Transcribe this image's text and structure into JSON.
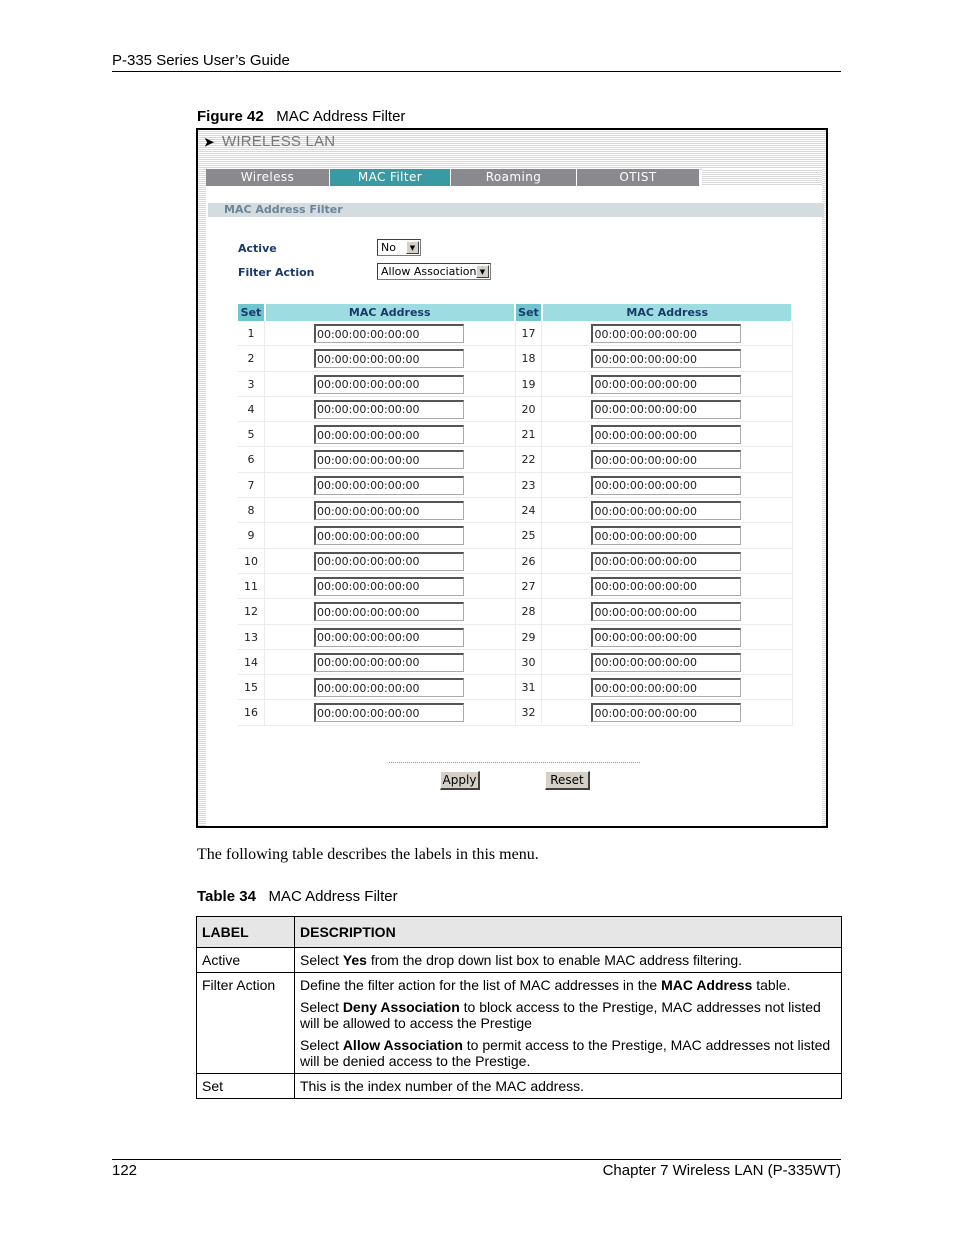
{
  "page": {
    "running_head": "P-335 Series User’s Guide",
    "page_number": "122",
    "chapter": "Chapter 7 Wireless LAN (P-335WT)"
  },
  "figure": {
    "label": "Figure 42",
    "title": "MAC Address Filter"
  },
  "screenshot": {
    "window_title": "WIRELESS LAN",
    "tabs": [
      {
        "label": "Wireless",
        "active": false
      },
      {
        "label": "MAC Filter",
        "active": true
      },
      {
        "label": "Roaming",
        "active": false
      },
      {
        "label": "OTIST",
        "active": false
      }
    ],
    "section_title": "MAC Address Filter",
    "active": {
      "label": "Active",
      "value": "No"
    },
    "filter_action": {
      "label": "Filter Action",
      "value": "Allow Association"
    },
    "columns": {
      "set": "Set",
      "mac": "MAC Address"
    },
    "left_rows": [
      {
        "set": "1",
        "mac": "00:00:00:00:00:00"
      },
      {
        "set": "2",
        "mac": "00:00:00:00:00:00"
      },
      {
        "set": "3",
        "mac": "00:00:00:00:00:00"
      },
      {
        "set": "4",
        "mac": "00:00:00:00:00:00"
      },
      {
        "set": "5",
        "mac": "00:00:00:00:00:00"
      },
      {
        "set": "6",
        "mac": "00:00:00:00:00:00"
      },
      {
        "set": "7",
        "mac": "00:00:00:00:00:00"
      },
      {
        "set": "8",
        "mac": "00:00:00:00:00:00"
      },
      {
        "set": "9",
        "mac": "00:00:00:00:00:00"
      },
      {
        "set": "10",
        "mac": "00:00:00:00:00:00"
      },
      {
        "set": "11",
        "mac": "00:00:00:00:00:00"
      },
      {
        "set": "12",
        "mac": "00:00:00:00:00:00"
      },
      {
        "set": "13",
        "mac": "00:00:00:00:00:00"
      },
      {
        "set": "14",
        "mac": "00:00:00:00:00:00"
      },
      {
        "set": "15",
        "mac": "00:00:00:00:00:00"
      },
      {
        "set": "16",
        "mac": "00:00:00:00:00:00"
      }
    ],
    "right_rows": [
      {
        "set": "17",
        "mac": "00:00:00:00:00:00"
      },
      {
        "set": "18",
        "mac": "00:00:00:00:00:00"
      },
      {
        "set": "19",
        "mac": "00:00:00:00:00:00"
      },
      {
        "set": "20",
        "mac": "00:00:00:00:00:00"
      },
      {
        "set": "21",
        "mac": "00:00:00:00:00:00"
      },
      {
        "set": "22",
        "mac": "00:00:00:00:00:00"
      },
      {
        "set": "23",
        "mac": "00:00:00:00:00:00"
      },
      {
        "set": "24",
        "mac": "00:00:00:00:00:00"
      },
      {
        "set": "25",
        "mac": "00:00:00:00:00:00"
      },
      {
        "set": "26",
        "mac": "00:00:00:00:00:00"
      },
      {
        "set": "27",
        "mac": "00:00:00:00:00:00"
      },
      {
        "set": "28",
        "mac": "00:00:00:00:00:00"
      },
      {
        "set": "29",
        "mac": "00:00:00:00:00:00"
      },
      {
        "set": "30",
        "mac": "00:00:00:00:00:00"
      },
      {
        "set": "31",
        "mac": "00:00:00:00:00:00"
      },
      {
        "set": "32",
        "mac": "00:00:00:00:00:00"
      }
    ],
    "buttons": {
      "apply": "Apply",
      "reset": "Reset"
    },
    "colors": {
      "tab_active": "#3a9aa4",
      "tab_inactive": "#8a8a8e",
      "table_header": "#9ddde2",
      "label_text": "#1a3a6a"
    }
  },
  "body_text": "The following table describes the labels in this menu.",
  "table": {
    "label": "Table 34",
    "title": "MAC Address Filter",
    "headers": [
      "LABEL",
      "DESCRIPTION"
    ],
    "rows": [
      {
        "label": "Active",
        "paragraphs": [
          [
            {
              "t": "Select "
            },
            {
              "t": "Yes",
              "b": true
            },
            {
              "t": " from the drop down list box to enable MAC address filtering."
            }
          ]
        ]
      },
      {
        "label": "Filter Action",
        "paragraphs": [
          [
            {
              "t": "Define the filter action for the list of MAC addresses in the "
            },
            {
              "t": "MAC Address",
              "b": true
            },
            {
              "t": " table."
            }
          ],
          [
            {
              "t": "Select "
            },
            {
              "t": "Deny Association",
              "b": true
            },
            {
              "t": " to block access to the Prestige, MAC addresses not listed will be allowed to access the Prestige"
            }
          ],
          [
            {
              "t": "Select "
            },
            {
              "t": "Allow Association",
              "b": true
            },
            {
              "t": " to permit access to the Prestige, MAC addresses not listed will be denied access to the Prestige."
            }
          ]
        ]
      },
      {
        "label": "Set",
        "paragraphs": [
          [
            {
              "t": "This is the index number of the MAC address."
            }
          ]
        ]
      }
    ]
  }
}
